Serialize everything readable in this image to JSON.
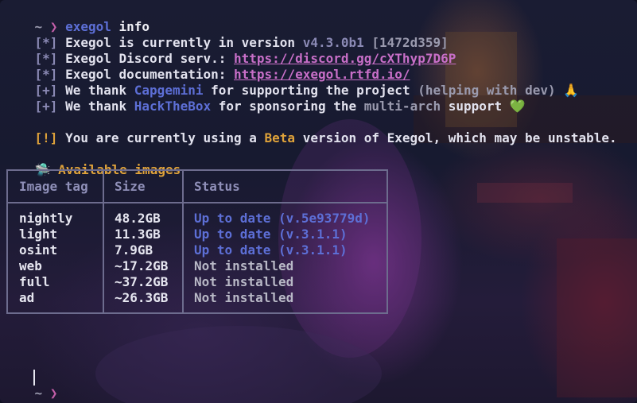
{
  "prompt": {
    "tilde": "~",
    "arrow": "❯"
  },
  "command": {
    "bin": "exegol",
    "arg": "info"
  },
  "lines": {
    "version": {
      "tag": "[*]",
      "text": "Exegol is currently in version ",
      "version": "v4.3.0b1",
      "hash": "[1472d359]"
    },
    "discord": {
      "tag": "[*]",
      "text": "Exegol Discord serv.: ",
      "url": "https://discord.gg/cXThyp7D6P"
    },
    "docs": {
      "tag": "[*]",
      "text": "Exegol documentation: ",
      "url": "https://exegol.rtfd.io/"
    },
    "thanks1": {
      "tag": "[+]",
      "pre": "We thank ",
      "sponsor": "Capgemini",
      "mid": " for supporting the project ",
      "note": "(helping with dev)",
      "emoji": "🙏"
    },
    "thanks2": {
      "tag": "[+]",
      "pre": "We thank ",
      "sponsor": "HackTheBox",
      "mid": " for sponsoring the ",
      "note": "multi-arch",
      "post": " support",
      "emoji": "💚"
    },
    "warning": {
      "tag": "[!]",
      "pre": "You are currently using a ",
      "beta": "Beta",
      "post": " version of Exegol, which may be unstable."
    }
  },
  "images_section": {
    "icon": "🛸",
    "title": "Available images"
  },
  "table": {
    "headers": [
      "Image tag",
      "Size",
      "Status"
    ],
    "rows": [
      {
        "tag": "nightly",
        "size": "48.2GB",
        "status": "Up to date (v.5e93779d)",
        "state": "ok"
      },
      {
        "tag": "light",
        "size": "11.3GB",
        "status": "Up to date (v.3.1.1)",
        "state": "ok"
      },
      {
        "tag": "osint",
        "size": "7.9GB",
        "status": "Up to date (v.3.1.1)",
        "state": "ok"
      },
      {
        "tag": "web",
        "size": "~17.2GB",
        "status": "Not installed",
        "state": "missing"
      },
      {
        "tag": "full",
        "size": "~37.2GB",
        "status": "Not installed",
        "state": "missing"
      },
      {
        "tag": "ad",
        "size": "~26.3GB",
        "status": "Not installed",
        "state": "missing"
      }
    ]
  },
  "colors": {
    "link": "#c86fc8",
    "sponsor": "#5d6fd6",
    "warning": "#e0a33a",
    "up_to_date": "#5d6fd6",
    "border": "#6d6c8e"
  }
}
